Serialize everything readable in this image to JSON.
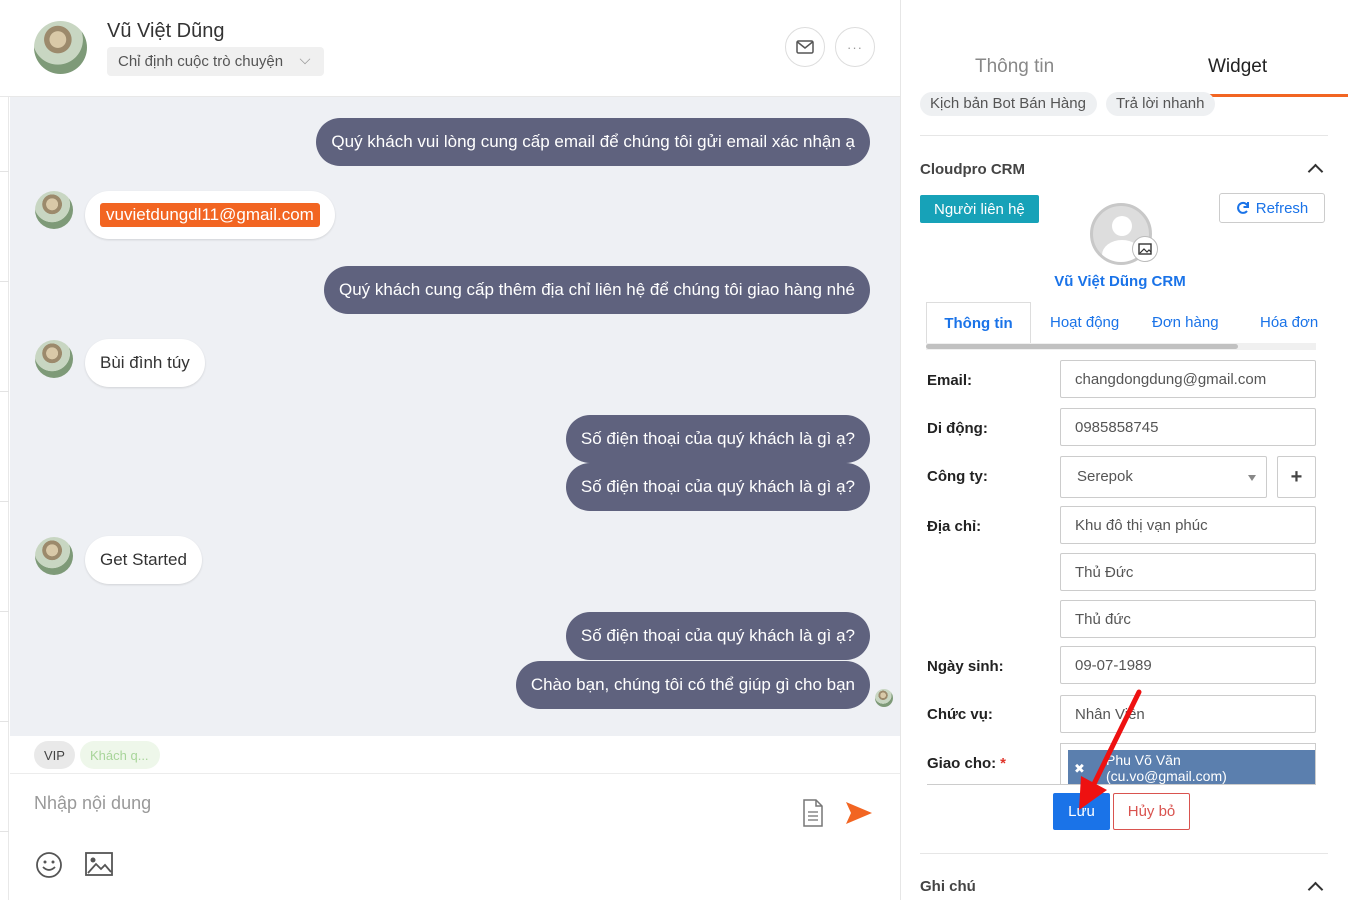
{
  "header": {
    "contact_name": "Vũ Việt Dũng",
    "assign_label": "Chỉ định cuộc trò chuyện"
  },
  "messages": [
    {
      "side": "out",
      "text": "Quý khách vui lòng cung cấp email để chúng tôi gửi email xác nhận ạ"
    },
    {
      "side": "in",
      "text": "vuvietdungdl11@gmail.com",
      "highlight": true
    },
    {
      "side": "out",
      "text": "Quý khách cung cấp thêm địa chỉ liên hệ để chúng tôi giao hàng nhé"
    },
    {
      "side": "in",
      "text": "Bùi đình túy"
    },
    {
      "side": "out",
      "text": "Số điện thoại của quý khách là gì ạ?"
    },
    {
      "side": "out",
      "text": "Số điện thoại của quý khách là gì ạ?"
    },
    {
      "side": "in",
      "text": "Get Started"
    },
    {
      "side": "out",
      "text": "Số điện thoại của quý khách là gì ạ?"
    },
    {
      "side": "out",
      "text": "Chào bạn, chúng tôi có thể giúp gì cho bạn"
    }
  ],
  "tags": [
    "VIP",
    "Khách q..."
  ],
  "composer": {
    "placeholder": "Nhập nội dung"
  },
  "panel": {
    "tabs": [
      "Thông tin",
      "Widget"
    ],
    "active_tab": "Widget",
    "chips": [
      "Kịch bản Bot Bán Hàng",
      "Trả lời nhanh"
    ],
    "crm_section": "Cloudpro CRM",
    "notes_section": "Ghi chú",
    "contact_badge": "Người liên hệ",
    "refresh_label": "Refresh",
    "crm_contact_name": "Vũ Việt Dũng CRM",
    "inner_tabs": [
      "Thông tin",
      "Hoạt động",
      "Đơn hàng",
      "Hóa đơn"
    ],
    "fields": {
      "email_label": "Email:",
      "email": "changdongdung@gmail.com",
      "mobile_label": "Di động:",
      "mobile": "0985858745",
      "company_label": "Công ty:",
      "company": "Serepok",
      "address_label": "Địa chỉ:",
      "address_1": "Khu đô thị vạn phúc",
      "address_2": "Thủ Đức",
      "address_3": "Thủ đức",
      "birthday_label": "Ngày sinh:",
      "birthday": "09-07-1989",
      "position_label": "Chức vụ:",
      "position": "Nhân Viên",
      "assignee_label": "Giao cho:",
      "assignee_required": "*",
      "assignee_name": "Phu Võ Văn",
      "assignee_email": "(cu.vo@gmail.com)"
    },
    "save_label": "Lưu",
    "cancel_label": "Hủy bỏ"
  },
  "colors": {
    "accent_orange": "#f26522",
    "bubble_out": "#5f627e",
    "link_blue": "#1a73e8",
    "badge_teal": "#17a2b8",
    "assignee_chip": "#5b7fae",
    "cancel_red": "#d9534f",
    "annotation_arrow": "#e11"
  }
}
